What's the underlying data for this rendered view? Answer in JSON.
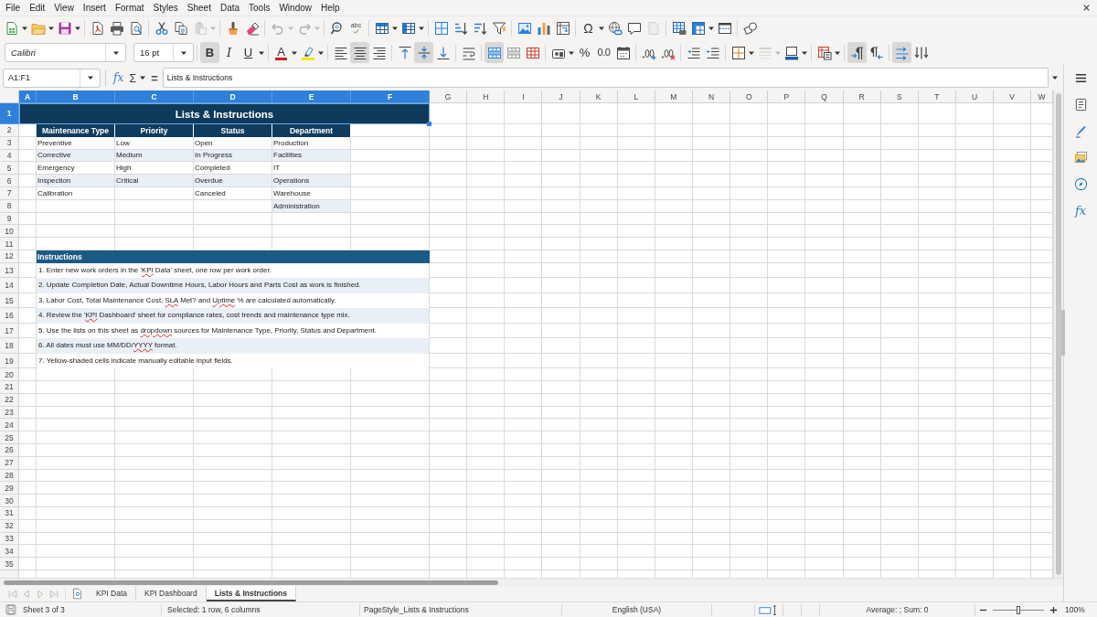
{
  "menu_bar": [
    "File",
    "Edit",
    "View",
    "Insert",
    "Format",
    "Styles",
    "Sheet",
    "Data",
    "Tools",
    "Window",
    "Help"
  ],
  "standard_toolbar": [
    [
      {
        "kind": "new",
        "disabled": false,
        "dropdown": true
      },
      {
        "kind": "open",
        "disabled": false,
        "dropdown": true
      },
      {
        "kind": "save",
        "disabled": false,
        "dropdown": true
      }
    ],
    [
      {
        "kind": "pdf",
        "disabled": false,
        "dropdown": false
      },
      {
        "kind": "print",
        "disabled": false,
        "dropdown": false
      },
      {
        "kind": "preview",
        "disabled": false,
        "dropdown": false
      }
    ],
    [
      {
        "kind": "cut",
        "disabled": false,
        "dropdown": false
      },
      {
        "kind": "copy",
        "disabled": false,
        "dropdown": false
      },
      {
        "kind": "paste",
        "disabled": true,
        "dropdown": true
      }
    ],
    [
      {
        "kind": "clone",
        "disabled": false,
        "dropdown": false
      },
      {
        "kind": "clear",
        "disabled": false,
        "dropdown": false
      }
    ],
    [
      {
        "kind": "undo",
        "disabled": true,
        "dropdown": true
      },
      {
        "kind": "redo",
        "disabled": true,
        "dropdown": true
      }
    ],
    [
      {
        "kind": "find",
        "disabled": false,
        "dropdown": false
      },
      {
        "kind": "spelling",
        "label": "abc",
        "disabled": false,
        "dropdown": false
      }
    ],
    [
      {
        "kind": "rows",
        "disabled": false,
        "dropdown": true
      },
      {
        "kind": "columns",
        "disabled": false,
        "dropdown": true
      }
    ],
    [
      {
        "kind": "sort",
        "disabled": false,
        "dropdown": false
      },
      {
        "kind": "ascending",
        "disabled": false,
        "dropdown": false
      },
      {
        "kind": "descending",
        "disabled": false,
        "dropdown": false
      },
      {
        "kind": "filter",
        "disabled": false,
        "dropdown": false
      }
    ],
    [
      {
        "kind": "image",
        "disabled": false,
        "dropdown": false
      },
      {
        "kind": "chart",
        "disabled": false,
        "dropdown": false
      },
      {
        "kind": "pivot",
        "disabled": false,
        "dropdown": false
      }
    ],
    [
      {
        "kind": "symbol",
        "label": "Ω",
        "disabled": false,
        "dropdown": true
      },
      {
        "kind": "hyperlink",
        "disabled": false,
        "dropdown": false
      },
      {
        "kind": "comment",
        "disabled": false,
        "dropdown": false
      },
      {
        "kind": "header",
        "disabled": true,
        "dropdown": false
      }
    ],
    [
      {
        "kind": "printarea",
        "disabled": false,
        "dropdown": false
      },
      {
        "kind": "freeze",
        "disabled": false,
        "dropdown": true
      },
      {
        "kind": "split",
        "disabled": false,
        "dropdown": false
      }
    ],
    [
      {
        "kind": "draw",
        "disabled": false,
        "dropdown": false
      }
    ]
  ],
  "format_toolbar": {
    "font_name": "Calibri",
    "font_size": "16 pt",
    "groups": [
      [
        {
          "kind": "bold",
          "label": "B",
          "on": true,
          "disabled": false,
          "dropdown": false
        },
        {
          "kind": "italic",
          "label": "I",
          "on": false,
          "disabled": false,
          "dropdown": false
        },
        {
          "kind": "underline",
          "label": "U",
          "on": false,
          "disabled": false,
          "dropdown": true
        }
      ],
      [
        {
          "kind": "fontcolor",
          "label": "A",
          "on": false,
          "disabled": false,
          "dropdown": true
        },
        {
          "kind": "highlight",
          "on": false,
          "disabled": false,
          "dropdown": true
        }
      ],
      [
        {
          "kind": "left",
          "on": false,
          "disabled": false,
          "dropdown": false
        },
        {
          "kind": "center",
          "on": true,
          "disabled": false,
          "dropdown": false
        },
        {
          "kind": "right",
          "on": false,
          "disabled": false,
          "dropdown": false
        }
      ],
      [
        {
          "kind": "top",
          "on": false,
          "disabled": false,
          "dropdown": false
        },
        {
          "kind": "middle",
          "on": true,
          "disabled": false,
          "dropdown": false
        },
        {
          "kind": "bottom",
          "on": false,
          "disabled": false,
          "dropdown": false
        }
      ],
      [
        {
          "kind": "wrap",
          "on": false,
          "disabled": false,
          "dropdown": false
        }
      ],
      [
        {
          "kind": "mergecenter",
          "on": true,
          "disabled": false,
          "dropdown": false
        },
        {
          "kind": "merge",
          "on": false,
          "disabled": false,
          "dropdown": false
        },
        {
          "kind": "unmerge",
          "on": false,
          "disabled": false,
          "dropdown": false
        }
      ],
      [
        {
          "kind": "currency",
          "on": false,
          "disabled": false,
          "dropdown": true
        },
        {
          "kind": "percent",
          "label": "%",
          "on": false,
          "disabled": false,
          "dropdown": false
        },
        {
          "kind": "decimal",
          "label": "0.0",
          "on": false,
          "disabled": false,
          "dropdown": false
        },
        {
          "kind": "date",
          "on": false,
          "disabled": false,
          "dropdown": false
        }
      ],
      [
        {
          "kind": "adddecimal",
          "on": false,
          "disabled": false,
          "dropdown": false
        },
        {
          "kind": "deldecimal",
          "on": false,
          "disabled": false,
          "dropdown": false
        }
      ],
      [
        {
          "kind": "indent",
          "on": false,
          "disabled": false,
          "dropdown": false
        },
        {
          "kind": "outdent",
          "on": false,
          "disabled": false,
          "dropdown": false
        }
      ],
      [
        {
          "kind": "borders",
          "on": false,
          "disabled": false,
          "dropdown": true
        },
        {
          "kind": "borderstyle",
          "on": false,
          "disabled": true,
          "dropdown": true
        },
        {
          "kind": "bordercolor",
          "on": false,
          "disabled": false,
          "dropdown": true
        }
      ],
      [
        {
          "kind": "conditional",
          "on": false,
          "disabled": false,
          "dropdown": true
        }
      ],
      [
        {
          "kind": "ltr",
          "on": true,
          "disabled": false,
          "dropdown": false
        },
        {
          "kind": "rtl",
          "on": false,
          "disabled": false,
          "dropdown": false
        }
      ],
      [
        {
          "kind": "textltr",
          "on": true,
          "disabled": false,
          "dropdown": false
        },
        {
          "kind": "textttb",
          "on": false,
          "disabled": false,
          "dropdown": false
        }
      ]
    ]
  },
  "formula_bar": {
    "name_box": "A1:F1",
    "wizard": "fx",
    "sum": "Σ",
    "equals": "=",
    "content": "Lists & Instructions"
  },
  "sidebar": [
    {
      "kind": "menu"
    },
    {
      "kind": "properties"
    },
    {
      "kind": "styles"
    },
    {
      "kind": "gallery"
    },
    {
      "kind": "navigator"
    },
    {
      "kind": "functions",
      "label": "fx"
    }
  ],
  "sheet": {
    "columns": [
      {
        "label": "A",
        "selected": true
      },
      {
        "label": "B",
        "selected": true
      },
      {
        "label": "C",
        "selected": true
      },
      {
        "label": "D",
        "selected": true
      },
      {
        "label": "E",
        "selected": true
      },
      {
        "label": "F",
        "selected": true
      },
      {
        "label": "G",
        "selected": false
      },
      {
        "label": "H",
        "selected": false
      },
      {
        "label": "I",
        "selected": false
      },
      {
        "label": "J",
        "selected": false
      },
      {
        "label": "K",
        "selected": false
      },
      {
        "label": "L",
        "selected": false
      },
      {
        "label": "M",
        "selected": false
      },
      {
        "label": "N",
        "selected": false
      },
      {
        "label": "O",
        "selected": false
      },
      {
        "label": "P",
        "selected": false
      },
      {
        "label": "Q",
        "selected": false
      },
      {
        "label": "R",
        "selected": false
      },
      {
        "label": "S",
        "selected": false
      },
      {
        "label": "T",
        "selected": false
      },
      {
        "label": "U",
        "selected": false
      },
      {
        "label": "V",
        "selected": false
      },
      {
        "label": "W",
        "selected": false
      }
    ],
    "rows": [
      {
        "label": "1",
        "selected": true
      },
      {
        "label": "2",
        "selected": false
      },
      {
        "label": "3",
        "selected": false
      },
      {
        "label": "4",
        "selected": false
      },
      {
        "label": "5",
        "selected": false
      },
      {
        "label": "6",
        "selected": false
      },
      {
        "label": "7",
        "selected": false
      },
      {
        "label": "8",
        "selected": false
      },
      {
        "label": "9",
        "selected": false
      },
      {
        "label": "10",
        "selected": false
      },
      {
        "label": "11",
        "selected": false
      },
      {
        "label": "12",
        "selected": false
      },
      {
        "label": "13",
        "selected": false
      },
      {
        "label": "14",
        "selected": false
      },
      {
        "label": "15",
        "selected": false
      },
      {
        "label": "16",
        "selected": false
      },
      {
        "label": "17",
        "selected": false
      },
      {
        "label": "18",
        "selected": false
      },
      {
        "label": "19",
        "selected": false
      },
      {
        "label": "20",
        "selected": false
      },
      {
        "label": "21",
        "selected": false
      },
      {
        "label": "22",
        "selected": false
      },
      {
        "label": "23",
        "selected": false
      },
      {
        "label": "24",
        "selected": false
      },
      {
        "label": "25",
        "selected": false
      },
      {
        "label": "26",
        "selected": false
      },
      {
        "label": "27",
        "selected": false
      },
      {
        "label": "28",
        "selected": false
      },
      {
        "label": "29",
        "selected": false
      },
      {
        "label": "30",
        "selected": false
      },
      {
        "label": "31",
        "selected": false
      },
      {
        "label": "32",
        "selected": false
      },
      {
        "label": "33",
        "selected": false
      },
      {
        "label": "34",
        "selected": false
      },
      {
        "label": "35",
        "selected": false
      }
    ],
    "title": {
      "text": "Lists & Instructions",
      "selected": true
    },
    "lists": [
      {
        "heading": "Maintenance Type",
        "items": [
          "Preventive",
          "Corrective",
          "Emergency",
          "Inspection",
          "Calibration"
        ]
      },
      {
        "heading": "Priority",
        "items": [
          "Low",
          "Medium",
          "High",
          "Critical"
        ]
      },
      {
        "heading": "Status",
        "items": [
          "Open",
          "In Progress",
          "Completed",
          "Overdue",
          "Canceled"
        ]
      },
      {
        "heading": "Department",
        "items": [
          "Production",
          "Facilities",
          "IT",
          "Operations",
          "Warehouse",
          "Administration"
        ]
      }
    ],
    "instructions": {
      "heading": "Instructions",
      "lines": [
        {
          "segments": [
            {
              "text": "1. Enter new work orders in the '",
              "misspelled": false
            },
            {
              "text": "KPI",
              "misspelled": true
            },
            {
              "text": " Data' sheet, one row per work order.",
              "misspelled": false
            }
          ]
        },
        {
          "segments": [
            {
              "text": "2. Update Completion Date, Actual Downtime Hours, Labor Hours and Parts Cost as work is finished.",
              "misspelled": false
            }
          ]
        },
        {
          "segments": [
            {
              "text": "3. Labor Cost, Total Maintenance Cost, ",
              "misspelled": false
            },
            {
              "text": "SLA",
              "misspelled": true
            },
            {
              "text": " Met? and ",
              "misspelled": false
            },
            {
              "text": "Uptime",
              "misspelled": true
            },
            {
              "text": " % are calculated automatically.",
              "misspelled": false
            }
          ]
        },
        {
          "segments": [
            {
              "text": "4. Review the '",
              "misspelled": false
            },
            {
              "text": "KPI",
              "misspelled": true
            },
            {
              "text": " Dashboard' sheet for compliance rates, cost trends and maintenance type mix.",
              "misspelled": false
            }
          ]
        },
        {
          "segments": [
            {
              "text": "5. Use the lists on this sheet as ",
              "misspelled": false
            },
            {
              "text": "dropdown",
              "misspelled": true
            },
            {
              "text": " sources for Maintenance Type, Priority, Status and Department.",
              "misspelled": false
            }
          ]
        },
        {
          "segments": [
            {
              "text": "6. All dates must use MM/DD/",
              "misspelled": false
            },
            {
              "text": "YYYY",
              "misspelled": true
            },
            {
              "text": " format.",
              "misspelled": false
            }
          ]
        },
        {
          "segments": [
            {
              "text": "7. Yellow-shaded cells indicate manually editable input fields.",
              "misspelled": false
            }
          ]
        }
      ]
    }
  },
  "sheet_tabs": {
    "navigation": [
      {
        "kind": "first",
        "disabled": true
      },
      {
        "kind": "previous",
        "disabled": true
      },
      {
        "kind": "next",
        "disabled": true
      },
      {
        "kind": "last",
        "disabled": true
      }
    ],
    "tabs": [
      {
        "label": "KPI Data",
        "selected": false
      },
      {
        "label": "KPI Dashboard",
        "selected": false
      },
      {
        "label": "Lists & Instructions",
        "selected": true
      }
    ]
  },
  "status_bar": {
    "sheet": "Sheet 3 of 3",
    "selection": "Selected: 1 row, 6 columns",
    "page_style": "PageStyle_Lists & Instructions",
    "language": "English (USA)",
    "summary": "Average: ; Sum: 0",
    "zoom": {
      "level": 0.5,
      "label": "100%"
    }
  }
}
